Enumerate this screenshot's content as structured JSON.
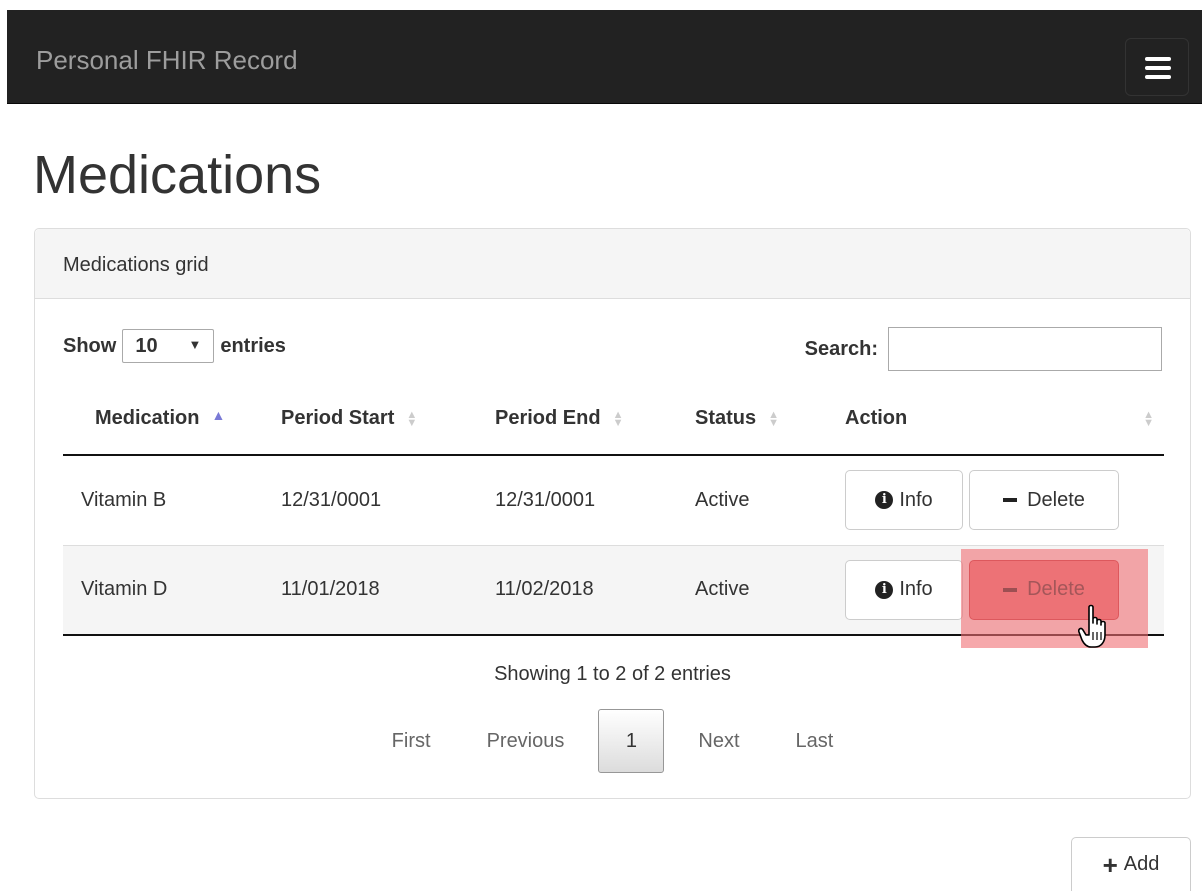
{
  "navbar": {
    "brand": "Personal FHIR Record",
    "toggle_icon": "hamburger-menu-icon"
  },
  "page": {
    "title": "Medications"
  },
  "panel": {
    "heading": "Medications grid"
  },
  "length_control": {
    "prefix": "Show",
    "value": "10",
    "suffix": "entries"
  },
  "search": {
    "label": "Search:",
    "value": "",
    "placeholder": ""
  },
  "table": {
    "columns": [
      "Medication",
      "Period Start",
      "Period End",
      "Status",
      "Action"
    ],
    "sorted_column": "Medication",
    "rows": [
      {
        "medication": "Vitamin B",
        "period_start": "12/31/0001",
        "period_end": "12/31/0001",
        "status": "Active",
        "info_label": "Info",
        "delete_label": "Delete"
      },
      {
        "medication": "Vitamin D",
        "period_start": "11/01/2018",
        "period_end": "11/02/2018",
        "status": "Active",
        "info_label": "Info",
        "delete_label": "Delete"
      }
    ]
  },
  "table_info": "Showing 1 to 2 of 2 entries",
  "pagination": {
    "first": "First",
    "previous": "Previous",
    "current": "1",
    "next": "Next",
    "last": "Last"
  },
  "add_button": {
    "label": "Add"
  },
  "colors": {
    "navbar_bg": "#222222",
    "delete_hover": "#e8797c",
    "highlight": "#f06e73",
    "sort_active": "#7a7ad6"
  }
}
